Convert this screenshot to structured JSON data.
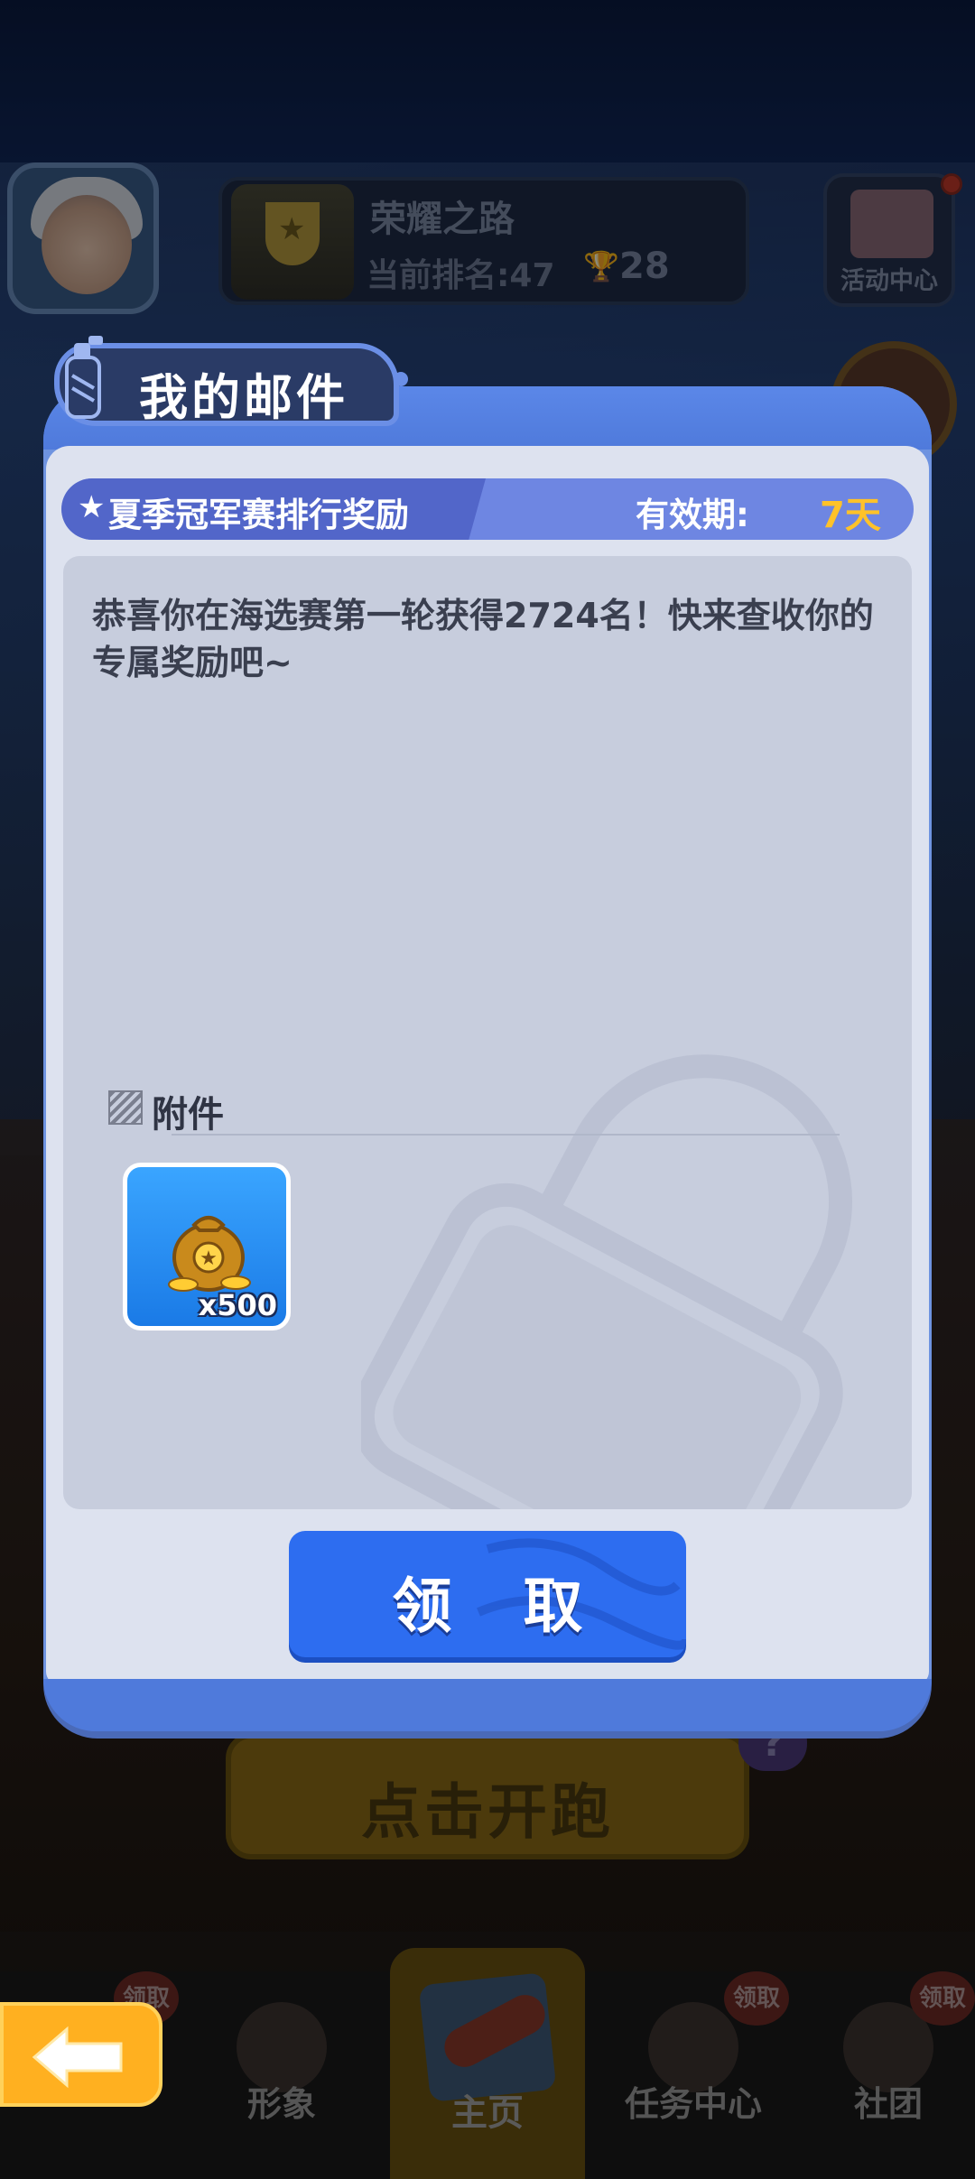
{
  "background": {
    "rank_card": {
      "title": "荣耀之路",
      "rank_line": "当前排名:47",
      "trophy_count": "28"
    },
    "event_center_label": "活动中心",
    "start_button_label": "点击开跑",
    "question_mark": "?"
  },
  "bottom_nav": {
    "items": [
      {
        "label": "",
        "badge": "领取"
      },
      {
        "label": "形象",
        "badge": ""
      },
      {
        "label": "主页",
        "badge": ""
      },
      {
        "label": "任务中心",
        "badge": "领取"
      },
      {
        "label": "社团",
        "badge": "领取"
      }
    ]
  },
  "dialog": {
    "title": "我的邮件",
    "mail": {
      "subject": "夏季冠军赛排行奖励",
      "validity_label": "有效期:",
      "validity_value": "7天",
      "body": "恭喜你在海选赛第一轮获得2724名！快来查收你的专属奖励吧~"
    },
    "attachments": {
      "header": "附件",
      "items": [
        {
          "name": "金币袋",
          "quantity": "x500"
        }
      ]
    },
    "claim_button": "领 取"
  },
  "colors": {
    "dialog_frame": "#6e93e0",
    "subject_bar": "#5266c9",
    "validity_value": "#ffc229",
    "claim_button": "#2d6df0",
    "back_button": "#ffb020"
  }
}
